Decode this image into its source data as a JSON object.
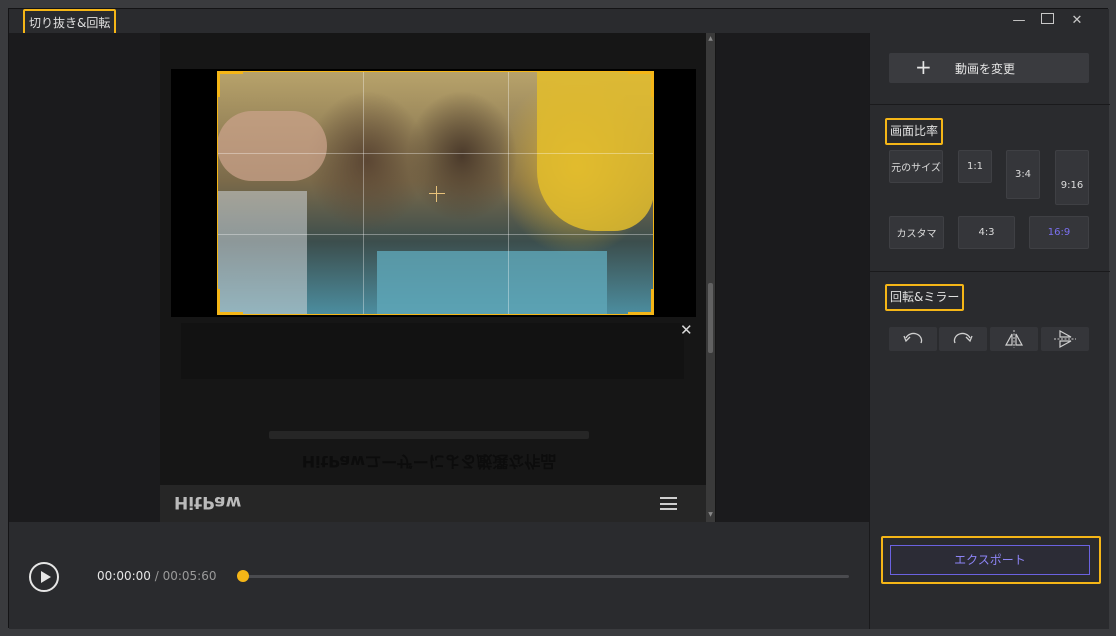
{
  "window": {
    "title": "切り抜き&回転",
    "controls": [
      "minimize-icon",
      "maximize-icon",
      "close-icon"
    ]
  },
  "preview": {
    "brand_logo": "HitPaw",
    "heading_mirrored": "HitPawユーザーによる厳選な作品",
    "dismiss_label": "✕"
  },
  "player": {
    "current_time": "00:00:00",
    "separator": " / ",
    "total_time": "00:05:60",
    "progress": 0.0,
    "accent_color": "#f5b617"
  },
  "panel": {
    "add_video_label": "動画を変更",
    "aspect_title": "画面比率",
    "aspect_options": [
      {
        "label": "元のサイズ",
        "active": false
      },
      {
        "label": "1:1",
        "active": false
      },
      {
        "label": "3:4",
        "active": false
      },
      {
        "label": "9:16",
        "active": false
      },
      {
        "label": "カスタマ",
        "active": false
      },
      {
        "label": "4:3",
        "active": false
      },
      {
        "label": "16:9",
        "active": true
      }
    ],
    "rotate_title": "回転&ミラー",
    "rotate_actions": [
      "rotate-left-icon",
      "rotate-right-icon",
      "flip-horizontal-icon",
      "flip-vertical-icon"
    ],
    "export_label": "エクスポート",
    "active_color": "#7b70f0"
  }
}
